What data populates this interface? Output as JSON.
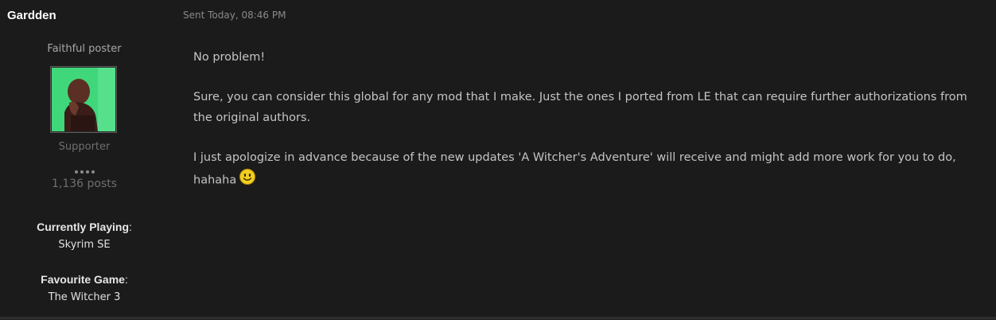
{
  "post": {
    "author": "Gardden",
    "date": "Sent Today, 08:46 PM",
    "sidebar": {
      "rank_title": "Faithful poster",
      "group": "Supporter",
      "post_count": "1,136 posts",
      "fields": [
        {
          "label": "Currently Playing",
          "value": "Skyrim SE"
        },
        {
          "label": "Favourite Game",
          "value": "The Witcher 3"
        }
      ]
    },
    "message": {
      "p1": "No problem!",
      "p2": "Sure, you can consider this global for any mod that I make. Just the ones I ported from LE that can require further authorizations from the original authors.",
      "p3": "I just apologize in advance because of the new updates 'A Witcher's Adventure' will receive and might add more work for you to do, hahaha",
      "emoticon": "smile-icon"
    },
    "colors": {
      "background": "#1b1b1b",
      "avatar_green": "#3fd77a",
      "smiley_yellow": "#f2cf1e"
    }
  }
}
